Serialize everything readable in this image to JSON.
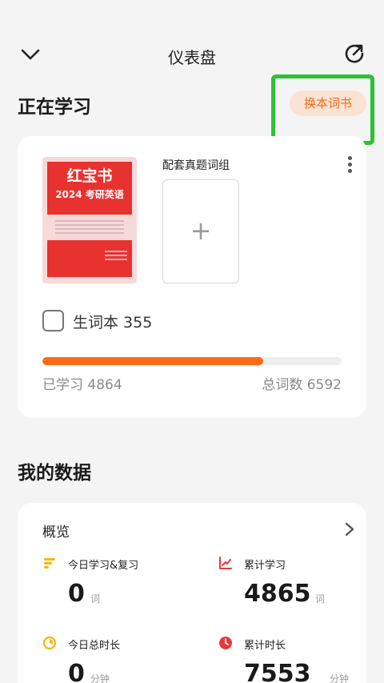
{
  "header": {
    "title": "仪表盘"
  },
  "learning": {
    "section_title": "正在学习",
    "change_book_label": "换本词书",
    "book_cover": {
      "title_line1": "红宝书",
      "title_line2": "2024 考研英语"
    },
    "matching_set_label": "配套真题词组",
    "add_symbol": "+",
    "vocab_book_label": "生词本 355",
    "progress_fraction": 0.737,
    "learned_label": "已学习 4864",
    "total_label": "总词数 6592"
  },
  "my_data": {
    "section_title": "我的数据",
    "overview_label": "概览",
    "stats": [
      {
        "label": "今日学习&复习",
        "value": "0",
        "unit": "词"
      },
      {
        "label": "累计学习",
        "value": "4865",
        "unit": "词"
      },
      {
        "label": "今日总时长",
        "value": "0",
        "unit": "分钟"
      },
      {
        "label": "累计时长",
        "value": "7553",
        "unit": "分钟"
      }
    ]
  },
  "colors": {
    "accent_orange": "#ff6a17",
    "highlight_green": "#2ec135",
    "cover_red": "#e8322f"
  },
  "icons": [
    "chevron-down-icon",
    "share-icon",
    "more-icon",
    "chevron-right-icon",
    "bars-icon",
    "trend-icon",
    "timer-icon",
    "clock-icon"
  ]
}
